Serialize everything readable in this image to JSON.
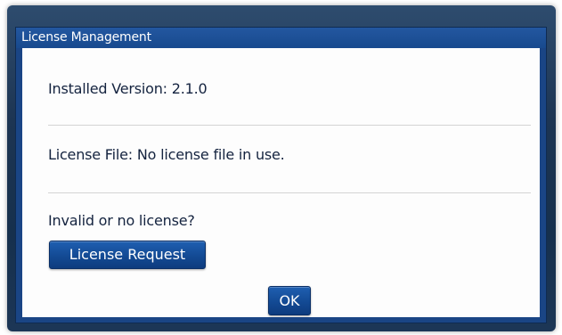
{
  "dialog": {
    "title": "License Management",
    "installed_version_label": "Installed Version: 2.1.0",
    "license_file_label": "License File: No license file in use.",
    "invalid_prompt": "Invalid or no license?",
    "license_request_button": "License Request",
    "ok_button": "OK"
  }
}
